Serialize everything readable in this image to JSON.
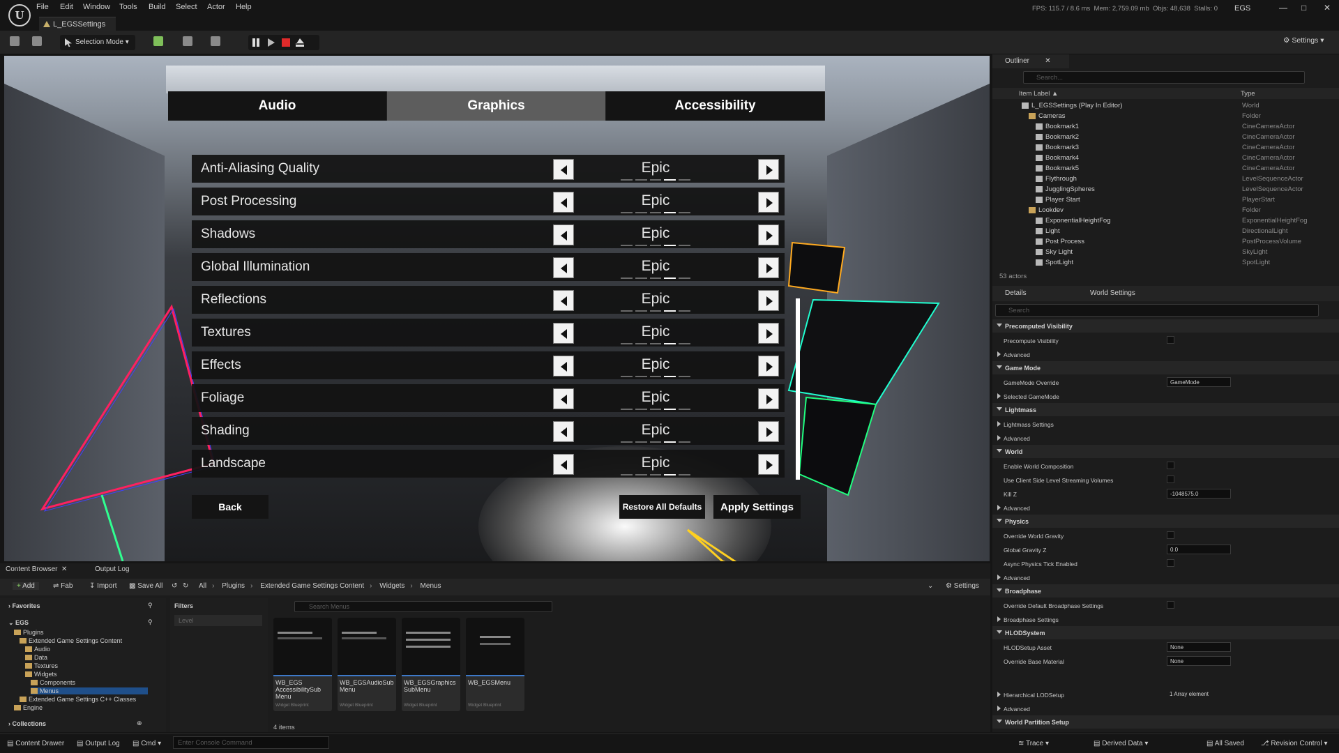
{
  "window": {
    "level_tab": "L_EGSSettings",
    "menu": [
      "File",
      "Edit",
      "Window",
      "Tools",
      "Build",
      "Select",
      "Actor",
      "Help"
    ],
    "stats": {
      "fps": "FPS: 115.7",
      "ms": "/ 8.6 ms",
      "mem": "Mem: 2,759.09 mb",
      "objs": "Objs: 48,638",
      "stalls": "Stalls: 0"
    },
    "project": "EGS"
  },
  "toolbar": {
    "selection_mode": "Selection Mode",
    "settings": "Settings"
  },
  "game_menu": {
    "tabs": [
      {
        "label": "Audio"
      },
      {
        "label": "Graphics"
      },
      {
        "label": "Accessibility"
      }
    ],
    "active_tab": "Graphics",
    "rows": [
      {
        "label": "Anti-Aliasing Quality",
        "value": "Epic",
        "level": 3
      },
      {
        "label": "Post Processing",
        "value": "Epic",
        "level": 3
      },
      {
        "label": "Shadows",
        "value": "Epic",
        "level": 3
      },
      {
        "label": "Global Illumination",
        "value": "Epic",
        "level": 3
      },
      {
        "label": "Reflections",
        "value": "Epic",
        "level": 3
      },
      {
        "label": "Textures",
        "value": "Epic",
        "level": 3
      },
      {
        "label": "Effects",
        "value": "Epic",
        "level": 3
      },
      {
        "label": "Foliage",
        "value": "Epic",
        "level": 3
      },
      {
        "label": "Shading",
        "value": "Epic",
        "level": 3
      },
      {
        "label": "Landscape",
        "value": "Epic",
        "level": 3
      }
    ],
    "back": "Back",
    "restore": "Restore All Defaults",
    "apply": "Apply Settings"
  },
  "outliner": {
    "tab": "Outliner",
    "search_placeholder": "Search...",
    "col_label": "Item Label ▲",
    "col_type": "Type",
    "items": [
      {
        "name": "L_EGSSettings (Play In Editor)",
        "type": "World",
        "indent": 0,
        "folder": false
      },
      {
        "name": "Cameras",
        "type": "Folder",
        "indent": 1,
        "folder": true
      },
      {
        "name": "Bookmark1",
        "type": "CineCameraActor",
        "indent": 2,
        "folder": false
      },
      {
        "name": "Bookmark2",
        "type": "CineCameraActor",
        "indent": 2,
        "folder": false
      },
      {
        "name": "Bookmark3",
        "type": "CineCameraActor",
        "indent": 2,
        "folder": false
      },
      {
        "name": "Bookmark4",
        "type": "CineCameraActor",
        "indent": 2,
        "folder": false
      },
      {
        "name": "Bookmark5",
        "type": "CineCameraActor",
        "indent": 2,
        "folder": false
      },
      {
        "name": "Flythrough",
        "type": "LevelSequenceActor",
        "indent": 2,
        "folder": false
      },
      {
        "name": "JugglingSpheres",
        "type": "LevelSequenceActor",
        "indent": 2,
        "folder": false
      },
      {
        "name": "Player Start",
        "type": "PlayerStart",
        "indent": 2,
        "folder": false
      },
      {
        "name": "Lookdev",
        "type": "Folder",
        "indent": 1,
        "folder": true
      },
      {
        "name": "ExponentialHeightFog",
        "type": "ExponentialHeightFog",
        "indent": 2,
        "folder": false
      },
      {
        "name": "Light",
        "type": "DirectionalLight",
        "indent": 2,
        "folder": false
      },
      {
        "name": "Post Process",
        "type": "PostProcessVolume",
        "indent": 2,
        "folder": false
      },
      {
        "name": "Sky Light",
        "type": "SkyLight",
        "indent": 2,
        "folder": false
      },
      {
        "name": "SpotLight",
        "type": "SpotLight",
        "indent": 2,
        "folder": false
      }
    ],
    "count": "53 actors"
  },
  "details": {
    "tab_details": "Details",
    "tab_world": "World Settings",
    "search_placeholder": "Search",
    "rows": [
      {
        "kind": "sec",
        "label": "Precomputed Visibility"
      },
      {
        "kind": "chk",
        "label": "Precompute Visibility"
      },
      {
        "kind": "adv",
        "label": "Advanced"
      },
      {
        "kind": "sec",
        "label": "Game Mode"
      },
      {
        "kind": "field",
        "label": "GameMode Override",
        "value": "GameMode"
      },
      {
        "kind": "adv",
        "label": "Selected GameMode"
      },
      {
        "kind": "sec",
        "label": "Lightmass"
      },
      {
        "kind": "adv",
        "label": "Lightmass Settings"
      },
      {
        "kind": "adv",
        "label": "Advanced"
      },
      {
        "kind": "sec",
        "label": "World"
      },
      {
        "kind": "chk",
        "label": "Enable World Composition"
      },
      {
        "kind": "chk",
        "label": "Use Client Side Level Streaming Volumes"
      },
      {
        "kind": "field",
        "label": "Kill Z",
        "value": "-1048575.0"
      },
      {
        "kind": "adv",
        "label": "Advanced"
      },
      {
        "kind": "sec",
        "label": "Physics"
      },
      {
        "kind": "chk",
        "label": "Override World Gravity"
      },
      {
        "kind": "field",
        "label": "Global Gravity Z",
        "value": "0.0"
      },
      {
        "kind": "chk",
        "label": "Async Physics Tick Enabled"
      },
      {
        "kind": "adv",
        "label": "Advanced"
      },
      {
        "kind": "sec",
        "label": "Broadphase"
      },
      {
        "kind": "chk",
        "label": "Override Default Broadphase Settings"
      },
      {
        "kind": "adv",
        "label": "Broadphase Settings"
      },
      {
        "kind": "sec",
        "label": "HLODSystem"
      },
      {
        "kind": "field",
        "label": "HLODSetup Asset",
        "value": "None"
      },
      {
        "kind": "field",
        "label": "Override Base Material",
        "value": "None"
      },
      {
        "kind": "spacer",
        "label": ""
      },
      {
        "kind": "adv",
        "label": "Hierarchical LODSetup",
        "value": "1 Array element"
      },
      {
        "kind": "adv",
        "label": "Advanced"
      },
      {
        "kind": "sec",
        "label": "World Partition Setup"
      }
    ]
  },
  "content_browser": {
    "tab_cb": "Content Browser",
    "tab_log": "Output Log",
    "add": "Add",
    "fab": "Fab",
    "import": "Import",
    "save_all": "Save All",
    "breadcrumb": [
      "All",
      "Plugins",
      "Extended Game Settings Content",
      "Widgets",
      "Menus"
    ],
    "settings": "Settings",
    "favorites": "Favorites",
    "root": "EGS",
    "tree": [
      {
        "label": "Plugins",
        "indent": 1
      },
      {
        "label": "Extended Game Settings Content",
        "indent": 2
      },
      {
        "label": "Audio",
        "indent": 3
      },
      {
        "label": "Data",
        "indent": 3
      },
      {
        "label": "Textures",
        "indent": 3
      },
      {
        "label": "Widgets",
        "indent": 3
      },
      {
        "label": "Components",
        "indent": 4
      },
      {
        "label": "Menus",
        "indent": 4
      },
      {
        "label": "Extended Game Settings C++ Classes",
        "indent": 2
      },
      {
        "label": "Engine",
        "indent": 1
      }
    ],
    "collections": "Collections",
    "filters": "Filters",
    "filter_level": "Level",
    "search_placeholder": "Search Menus",
    "assets": [
      {
        "name": "WB_EGS AccessibilitySub Menu",
        "type": "Widget Blueprint"
      },
      {
        "name": "WB_EGSAudioSub Menu",
        "type": "Widget Blueprint"
      },
      {
        "name": "WB_EGSGraphics SubMenu",
        "type": "Widget Blueprint"
      },
      {
        "name": "WB_EGSMenu",
        "type": "Widget Blueprint"
      }
    ],
    "item_count": "4 items"
  },
  "statusbar": {
    "content_drawer": "Content Drawer",
    "output_log": "Output Log",
    "cmd": "Cmd",
    "console_placeholder": "Enter Console Command",
    "trace": "Trace",
    "derived": "Derived Data",
    "saved": "All Saved",
    "revision": "Revision Control"
  }
}
